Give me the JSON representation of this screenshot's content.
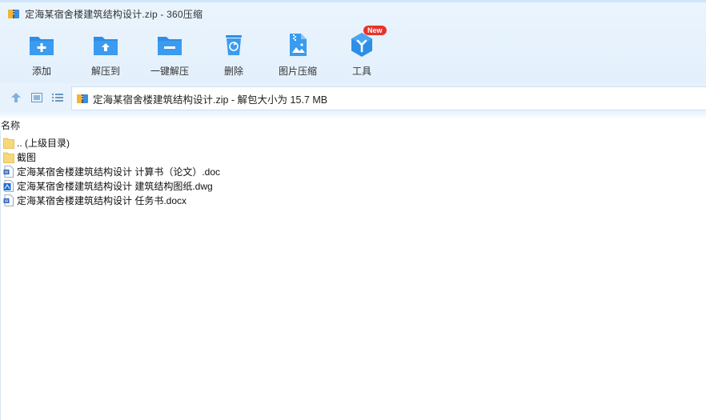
{
  "window": {
    "title": "定海某宿舍楼建筑结构设计.zip - 360压缩"
  },
  "toolbar": {
    "items": [
      {
        "label": "添加",
        "icon": "add-folder-icon"
      },
      {
        "label": "解压到",
        "icon": "extract-to-icon"
      },
      {
        "label": "一键解压",
        "icon": "one-click-extract-icon"
      },
      {
        "label": "删除",
        "icon": "trash-icon"
      },
      {
        "label": "图片压缩",
        "icon": "image-compress-icon"
      },
      {
        "label": "工具",
        "icon": "tools-icon",
        "badge": "New"
      }
    ]
  },
  "address": {
    "text": "定海某宿舍楼建筑结构设计.zip - 解包大小为 15.7 MB"
  },
  "list": {
    "column_name": "名称",
    "files": [
      {
        "name": ".. (上级目录)",
        "icon": "folder-icon"
      },
      {
        "name": "截图",
        "icon": "folder-icon"
      },
      {
        "name": "定海某宿舍楼建筑结构设计 计算书（论文）.doc",
        "icon": "word-doc-icon"
      },
      {
        "name": "定海某宿舍楼建筑结构设计 建筑结构图纸.dwg",
        "icon": "dwg-file-icon"
      },
      {
        "name": "定海某宿舍楼建筑结构设计 任务书.docx",
        "icon": "word-doc-icon"
      }
    ]
  },
  "colors": {
    "accent": "#2f8fe6",
    "header_bg": "#e6f1fc",
    "folder": "#f6d779",
    "badge": "#e8332b"
  }
}
